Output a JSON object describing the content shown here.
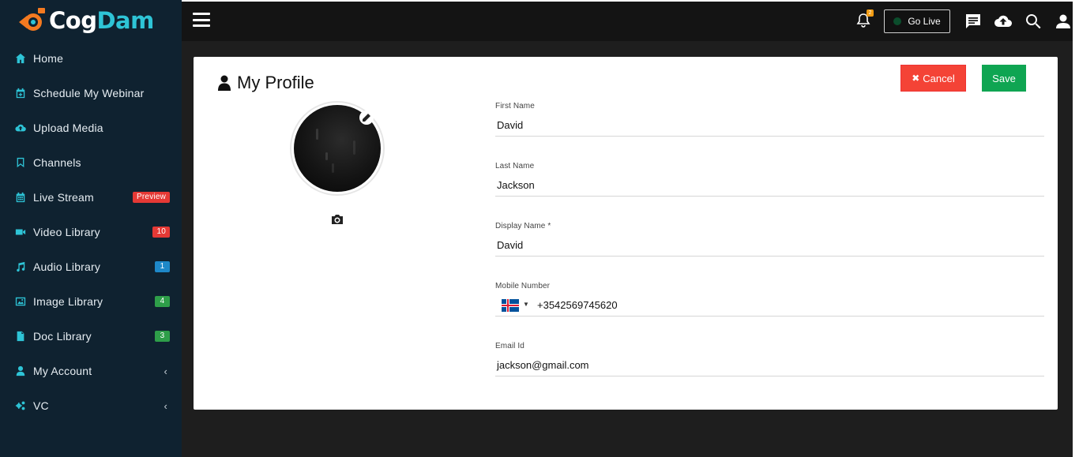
{
  "brand": {
    "logo_part1": "Cog",
    "logo_part2": "Dam",
    "accent": "#2ec4d6"
  },
  "sidebar": {
    "items": [
      {
        "label": "Home",
        "icon": "home-icon"
      },
      {
        "label": "Schedule My Webinar",
        "icon": "calendar-plus-icon"
      },
      {
        "label": "Upload Media",
        "icon": "cloud-upload-icon"
      },
      {
        "label": "Channels",
        "icon": "bookmark-icon"
      },
      {
        "label": "Live Stream",
        "icon": "calendar-icon",
        "badge": "Preview",
        "badge_color": "#e53935"
      },
      {
        "label": "Video Library",
        "icon": "video-camera-icon",
        "badge": "10",
        "badge_color": "#e53935"
      },
      {
        "label": "Audio Library",
        "icon": "music-note-icon",
        "badge": "1",
        "badge_color": "#1e88c8"
      },
      {
        "label": "Image Library",
        "icon": "image-icon",
        "badge": "4",
        "badge_color": "#2e9e49"
      },
      {
        "label": "Doc Library",
        "icon": "document-icon",
        "badge": "3",
        "badge_color": "#2e9e49"
      },
      {
        "label": "My Account",
        "icon": "user-icon",
        "chevron": "‹"
      },
      {
        "label": "VC",
        "icon": "cogs-icon",
        "chevron": "‹"
      }
    ]
  },
  "topbar": {
    "notification_count": "2",
    "go_live_label": "Go Live"
  },
  "profile": {
    "title": "My Profile",
    "cancel_label": "Cancel",
    "cancel_glyph": "✖",
    "save_label": "Save",
    "fields": {
      "first_name": {
        "label": "First Name",
        "value": "David"
      },
      "last_name": {
        "label": "Last Name",
        "value": "Jackson"
      },
      "display_name": {
        "label": "Display Name *",
        "value": "David"
      },
      "mobile": {
        "label": "Mobile Number",
        "value": "+3542569745620",
        "country": "Iceland"
      },
      "email": {
        "label": "Email Id",
        "value": "jackson@gmail.com"
      }
    }
  }
}
